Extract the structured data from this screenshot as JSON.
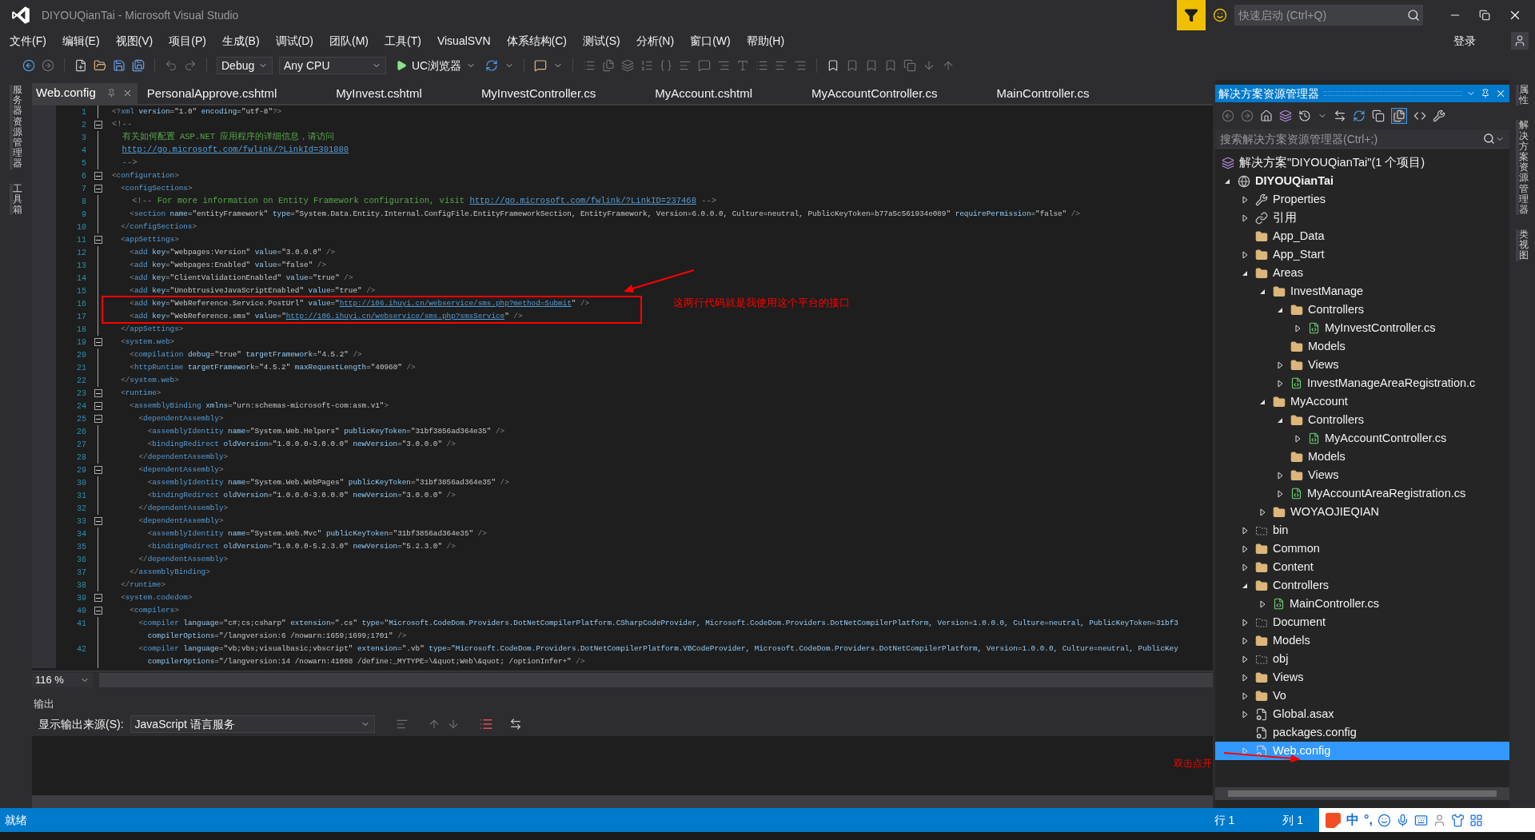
{
  "window": {
    "title": "DIYOUQianTai - Microsoft Visual Studio"
  },
  "quick_launch": {
    "placeholder": "快速启动 (Ctrl+Q)"
  },
  "menu": [
    "文件(F)",
    "编辑(E)",
    "视图(V)",
    "项目(P)",
    "生成(B)",
    "调试(D)",
    "团队(M)",
    "工具(T)",
    "VisualSVN",
    "体系结构(C)",
    "测试(S)",
    "分析(N)",
    "窗口(W)",
    "帮助(H)"
  ],
  "sign_in": "登录",
  "toolbar": {
    "configuration": "Debug",
    "platform": "Any CPU",
    "run": "UC浏览器"
  },
  "left_dock": [
    "服务器资源管理器",
    "工具箱"
  ],
  "right_dock": [
    "属性",
    "解决方案资源管理器",
    "类视图"
  ],
  "tabs": [
    {
      "label": "Web.config",
      "selected": true
    },
    {
      "label": "PersonalApprove.cshtml",
      "selected": false
    },
    {
      "label": "MyInvest.cshtml",
      "selected": false
    },
    {
      "label": "MyInvestController.cs",
      "selected": false
    },
    {
      "label": "MyAccount.cshtml",
      "selected": false
    },
    {
      "label": "MyAccountController.cs",
      "selected": false
    },
    {
      "label": "MainController.cs",
      "selected": false
    }
  ],
  "editor": {
    "zoom": "116 %",
    "annotation": "这两行代码就是我使用这个平台的接口",
    "lines": [
      {
        "n": "1",
        "kind": "code",
        "fold": false,
        "text": "<?xml version=\"1.0\" encoding=\"utf-8\"?>"
      },
      {
        "n": "2",
        "kind": "comment",
        "fold": true,
        "text": "<!--"
      },
      {
        "n": "3",
        "kind": "comment",
        "fold": false,
        "text": "  有关如何配置 ASP.NET 应用程序的详细信息，请访问"
      },
      {
        "n": "4",
        "kind": "comment",
        "fold": false,
        "text": "  http://go.microsoft.com/fwlink/?LinkId=301880"
      },
      {
        "n": "5",
        "kind": "comment",
        "fold": false,
        "text": "  -->"
      },
      {
        "n": "6",
        "kind": "code",
        "fold": true,
        "text": "<configuration>"
      },
      {
        "n": "7",
        "kind": "code",
        "fold": true,
        "text": "  <configSections>"
      },
      {
        "n": "8",
        "kind": "comment",
        "fold": false,
        "text": "    <!-- For more information on Entity Framework configuration, visit http://go.microsoft.com/fwlink/?LinkID=237468 -->"
      },
      {
        "n": "9",
        "kind": "code",
        "fold": false,
        "text": "    <section name=\"entityFramework\" type=\"System.Data.Entity.Internal.ConfigFile.EntityFrameworkSection, EntityFramework, Version=6.0.0.0, Culture=neutral, PublicKeyToken=b77a5c561934e089\" requirePermission=\"false\" />"
      },
      {
        "n": "10",
        "kind": "code",
        "fold": false,
        "text": "  </configSections>"
      },
      {
        "n": "11",
        "kind": "code",
        "fold": true,
        "text": "  <appSettings>"
      },
      {
        "n": "12",
        "kind": "code",
        "fold": false,
        "text": "    <add key=\"webpages:Version\" value=\"3.0.0.0\" />"
      },
      {
        "n": "13",
        "kind": "code",
        "fold": false,
        "text": "    <add key=\"webpages:Enabled\" value=\"false\" />"
      },
      {
        "n": "14",
        "kind": "code",
        "fold": false,
        "text": "    <add key=\"ClientValidationEnabled\" value=\"true\" />"
      },
      {
        "n": "15",
        "kind": "code",
        "fold": false,
        "text": "    <add key=\"UnobtrusiveJavaScriptEnabled\" value=\"true\" />"
      },
      {
        "n": "16",
        "kind": "code",
        "fold": false,
        "text": "    <add key=\"WebReference.Service.PostUrl\" value=\"http://106.ihuyi.cn/webservice/sms.php?method=Submit\" />"
      },
      {
        "n": "17",
        "kind": "code",
        "fold": false,
        "text": "    <add key=\"WebReference.sms\" value=\"http://106.ihuyi.cn/webservice/sms.php?smsService\" />"
      },
      {
        "n": "18",
        "kind": "code",
        "fold": false,
        "text": "  </appSettings>"
      },
      {
        "n": "19",
        "kind": "code",
        "fold": true,
        "text": "  <system.web>"
      },
      {
        "n": "20",
        "kind": "code",
        "fold": false,
        "text": "    <compilation debug=\"true\" targetFramework=\"4.5.2\" />"
      },
      {
        "n": "21",
        "kind": "code",
        "fold": false,
        "text": "    <httpRuntime targetFramework=\"4.5.2\" maxRequestLength=\"40960\" />"
      },
      {
        "n": "22",
        "kind": "code",
        "fold": false,
        "text": "  </system.web>"
      },
      {
        "n": "23",
        "kind": "code",
        "fold": true,
        "text": "  <runtime>"
      },
      {
        "n": "24",
        "kind": "code",
        "fold": true,
        "text": "    <assemblyBinding xmlns=\"urn:schemas-microsoft-com:asm.v1\">"
      },
      {
        "n": "25",
        "kind": "code",
        "fold": true,
        "text": "      <dependentAssembly>"
      },
      {
        "n": "26",
        "kind": "code",
        "fold": false,
        "text": "        <assemblyIdentity name=\"System.Web.Helpers\" publicKeyToken=\"31bf3856ad364e35\" />"
      },
      {
        "n": "27",
        "kind": "code",
        "fold": false,
        "text": "        <bindingRedirect oldVersion=\"1.0.0.0-3.0.0.0\" newVersion=\"3.0.0.0\" />"
      },
      {
        "n": "28",
        "kind": "code",
        "fold": false,
        "text": "      </dependentAssembly>"
      },
      {
        "n": "29",
        "kind": "code",
        "fold": true,
        "text": "      <dependentAssembly>"
      },
      {
        "n": "30",
        "kind": "code",
        "fold": false,
        "text": "        <assemblyIdentity name=\"System.Web.WebPages\" publicKeyToken=\"31bf3856ad364e35\" />"
      },
      {
        "n": "31",
        "kind": "code",
        "fold": false,
        "text": "        <bindingRedirect oldVersion=\"1.0.0.0-3.0.0.0\" newVersion=\"3.0.0.0\" />"
      },
      {
        "n": "32",
        "kind": "code",
        "fold": false,
        "text": "      </dependentAssembly>"
      },
      {
        "n": "33",
        "kind": "code",
        "fold": true,
        "text": "      <dependentAssembly>"
      },
      {
        "n": "34",
        "kind": "code",
        "fold": false,
        "text": "        <assemblyIdentity name=\"System.Web.Mvc\" publicKeyToken=\"31bf3856ad364e35\" />"
      },
      {
        "n": "35",
        "kind": "code",
        "fold": false,
        "text": "        <bindingRedirect oldVersion=\"1.0.0.0-5.2.3.0\" newVersion=\"5.2.3.0\" />"
      },
      {
        "n": "36",
        "kind": "code",
        "fold": false,
        "text": "      </dependentAssembly>"
      },
      {
        "n": "37",
        "kind": "code",
        "fold": false,
        "text": "    </assemblyBinding>"
      },
      {
        "n": "38",
        "kind": "code",
        "fold": false,
        "text": "  </runtime>"
      },
      {
        "n": "39",
        "kind": "code",
        "fold": true,
        "text": "  <system.codedom>"
      },
      {
        "n": "40",
        "kind": "code",
        "fold": true,
        "text": "    <compilers>"
      },
      {
        "n": "41",
        "kind": "code",
        "fold": false,
        "text": "      <compiler language=\"c#;cs;csharp\" extension=\".cs\" type=\"Microsoft.CodeDom.Providers.DotNetCompilerPlatform.CSharpCodeProvider, Microsoft.CodeDom.Providers.DotNetCompilerPlatform, Version=1.0.0.0, Culture=neutral, PublicKeyToken=31bf3",
        "wrap": "        compilerOptions=\"/langversion:6 /nowarn:1659;1699;1701\" />"
      },
      {
        "n": "42",
        "kind": "code",
        "fold": false,
        "text": "      <compiler language=\"vb;vbs;visualbasic;vbscript\" extension=\".vb\" type=\"Microsoft.CodeDom.Providers.DotNetCompilerPlatform.VBCodeProvider, Microsoft.CodeDom.Providers.DotNetCompilerPlatform, Version=1.0.0.0, Culture=neutral, PublicKey",
        "wrap": "        compilerOptions=\"/langversion:14 /nowarn:41008 /define:_MYTYPE=\\&quot;Web\\&quot; /optionInfer+\" />"
      }
    ]
  },
  "output": {
    "title": "输出",
    "source_label": "显示输出来源(S):",
    "source": "JavaScript 语言服务"
  },
  "solution_explorer": {
    "title": "解决方案资源管理器",
    "search": {
      "placeholder": "搜索解决方案资源管理器(Ctrl+;)"
    },
    "annotation": "双击点开",
    "tree": [
      {
        "label": "解决方案\"DIYOUQianTai\"(1 个项目)",
        "kind": "solution",
        "selected": false,
        "children": [
          {
            "label": "DIYOUQianTai",
            "kind": "project",
            "expanded": true,
            "selected": false,
            "children": [
              {
                "label": "Properties",
                "kind": "wrench",
                "expanded": false,
                "selected": false
              },
              {
                "label": "引用",
                "kind": "references",
                "expanded": false,
                "selected": false
              },
              {
                "label": "App_Data",
                "kind": "folder",
                "selected": false
              },
              {
                "label": "App_Start",
                "kind": "folder",
                "expanded": false,
                "selected": false
              },
              {
                "label": "Areas",
                "kind": "folder",
                "expanded": true,
                "selected": false,
                "children": [
                  {
                    "label": "InvestManage",
                    "kind": "folder",
                    "expanded": true,
                    "selected": false,
                    "children": [
                      {
                        "label": "Controllers",
                        "kind": "folder",
                        "expanded": true,
                        "selected": false,
                        "children": [
                          {
                            "label": "MyInvestController.cs",
                            "kind": "csharp",
                            "expanded": false,
                            "selected": false
                          }
                        ]
                      },
                      {
                        "label": "Models",
                        "kind": "folder",
                        "selected": false
                      },
                      {
                        "label": "Views",
                        "kind": "folder",
                        "expanded": false,
                        "selected": false
                      },
                      {
                        "label": "InvestManageAreaRegistration.c",
                        "kind": "csharp",
                        "expanded": false,
                        "selected": false
                      }
                    ]
                  },
                  {
                    "label": "MyAccount",
                    "kind": "folder",
                    "expanded": true,
                    "selected": false,
                    "children": [
                      {
                        "label": "Controllers",
                        "kind": "folder",
                        "expanded": true,
                        "selected": false,
                        "children": [
                          {
                            "label": "MyAccountController.cs",
                            "kind": "csharp",
                            "expanded": false,
                            "selected": false
                          }
                        ]
                      },
                      {
                        "label": "Models",
                        "kind": "folder",
                        "selected": false
                      },
                      {
                        "label": "Views",
                        "kind": "folder",
                        "expanded": false,
                        "selected": false
                      },
                      {
                        "label": "MyAccountAreaRegistration.cs",
                        "kind": "csharp",
                        "expanded": false,
                        "selected": false
                      }
                    ]
                  },
                  {
                    "label": "WOYAOJIEQIAN",
                    "kind": "folder",
                    "expanded": false,
                    "selected": false
                  }
                ]
              },
              {
                "label": "bin",
                "kind": "hidden-folder",
                "expanded": false,
                "selected": false
              },
              {
                "label": "Common",
                "kind": "folder",
                "expanded": false,
                "selected": false
              },
              {
                "label": "Content",
                "kind": "folder",
                "expanded": false,
                "selected": false
              },
              {
                "label": "Controllers",
                "kind": "folder",
                "expanded": true,
                "selected": false,
                "children": [
                  {
                    "label": "MainController.cs",
                    "kind": "csharp",
                    "expanded": false,
                    "selected": false
                  }
                ]
              },
              {
                "label": "Document",
                "kind": "hidden-folder",
                "expanded": false,
                "selected": false
              },
              {
                "label": "Models",
                "kind": "folder",
                "expanded": false,
                "selected": false
              },
              {
                "label": "obj",
                "kind": "hidden-folder",
                "expanded": false,
                "selected": false
              },
              {
                "label": "Views",
                "kind": "folder",
                "expanded": false,
                "selected": false
              },
              {
                "label": "Vo",
                "kind": "folder",
                "expanded": false,
                "selected": false
              },
              {
                "label": "Global.asax",
                "kind": "gear-file",
                "expanded": false,
                "selected": false
              },
              {
                "label": "packages.config",
                "kind": "config",
                "selected": false
              },
              {
                "label": "Web.config",
                "kind": "config",
                "expanded": false,
                "selected": true
              }
            ]
          }
        ]
      }
    ]
  },
  "status_bar": {
    "message": "就绪",
    "line": "行 1",
    "column": "列 1"
  },
  "ime_bar": [
    "中",
    "°,"
  ]
}
